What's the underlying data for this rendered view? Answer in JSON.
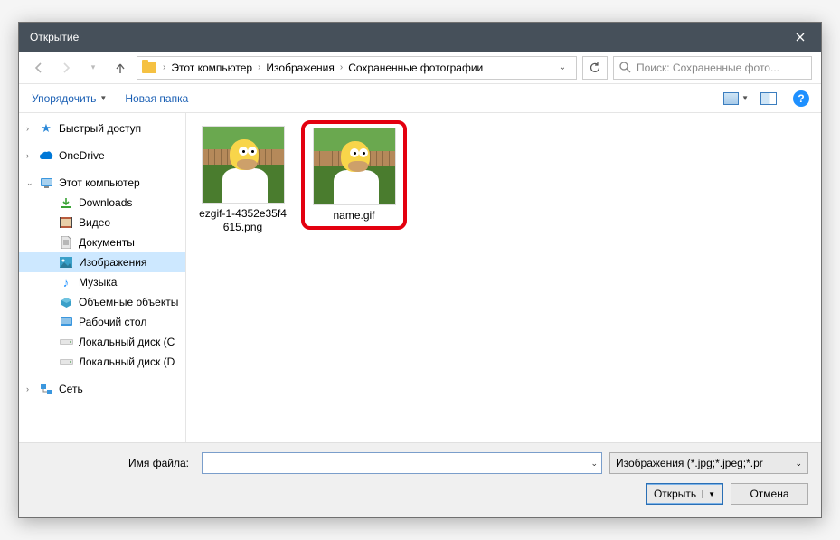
{
  "titlebar": {
    "title": "Открытие"
  },
  "addressbar": {
    "crumbs": [
      "Этот компьютер",
      "Изображения",
      "Сохраненные фотографии"
    ],
    "search_placeholder": "Поиск: Сохраненные фото..."
  },
  "toolbar": {
    "organize": "Упорядочить",
    "new_folder": "Новая папка"
  },
  "sidebar": {
    "quick_access": "Быстрый доступ",
    "onedrive": "OneDrive",
    "this_pc": "Этот компьютер",
    "downloads": "Downloads",
    "videos": "Видео",
    "documents": "Документы",
    "pictures": "Изображения",
    "music": "Музыка",
    "objects3d": "Объемные объекты",
    "desktop": "Рабочий стол",
    "local_c": "Локальный диск (C",
    "local_d": "Локальный диск (D",
    "network": "Сеть"
  },
  "files": [
    {
      "name": "ezgif-1-4352e35f4615.png",
      "selected": false
    },
    {
      "name": "name.gif",
      "selected": true
    }
  ],
  "bottom": {
    "filename_label": "Имя файла:",
    "filename_value": "",
    "filter_label": "Изображения (*.jpg;*.jpeg;*.pr",
    "open_btn": "Открыть",
    "cancel_btn": "Отмена"
  }
}
